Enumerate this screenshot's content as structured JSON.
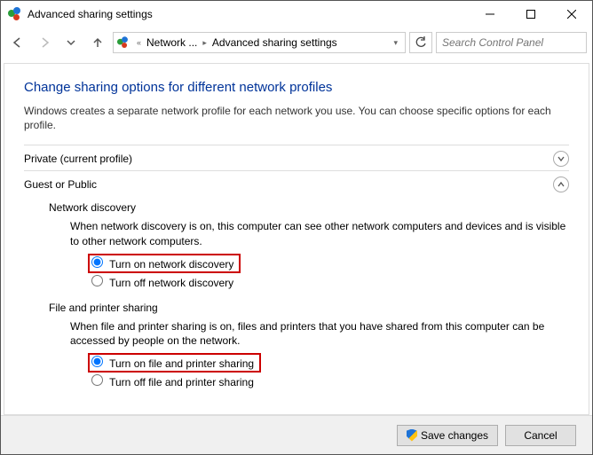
{
  "window": {
    "title": "Advanced sharing settings"
  },
  "breadcrumb": {
    "item1": "Network ...",
    "item2": "Advanced sharing settings"
  },
  "search": {
    "placeholder": "Search Control Panel"
  },
  "page": {
    "heading": "Change sharing options for different network profiles",
    "description": "Windows creates a separate network profile for each network you use. You can choose specific options for each profile."
  },
  "sections": {
    "private": {
      "label": "Private (current profile)"
    },
    "guest": {
      "label": "Guest or Public"
    }
  },
  "network_discovery": {
    "title": "Network discovery",
    "description": "When network discovery is on, this computer can see other network computers and devices and is visible to other network computers.",
    "option_on": "Turn on network discovery",
    "option_off": "Turn off network discovery"
  },
  "file_printer": {
    "title": "File and printer sharing",
    "description": "When file and printer sharing is on, files and printers that you have shared from this computer can be accessed by people on the network.",
    "option_on": "Turn on file and printer sharing",
    "option_off": "Turn off file and printer sharing"
  },
  "footer": {
    "save": "Save changes",
    "cancel": "Cancel"
  }
}
